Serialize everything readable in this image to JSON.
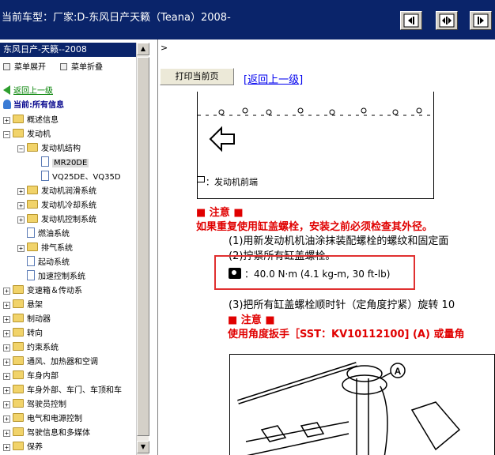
{
  "titlebar": {
    "title": "当前车型：厂家:D-东风日产天籁（Teana）2008-",
    "buttons": [
      "collapse-left-icon",
      "split-view-icon",
      "collapse-right-icon"
    ]
  },
  "sidebar": {
    "header": "东风日产-天籁--2008",
    "expand_label": "菜单展开",
    "collapse_label": "菜单折叠",
    "back_label": "返回上一级",
    "current_label": "当前:所有信息",
    "tree": [
      {
        "label": "概述信息",
        "type": "folder",
        "level": 0,
        "expanded": false
      },
      {
        "label": "发动机",
        "type": "folder",
        "level": 0,
        "expanded": true
      },
      {
        "label": "发动机结构",
        "type": "folder",
        "level": 1,
        "expanded": true
      },
      {
        "label": "MR20DE",
        "type": "doc",
        "level": 2,
        "selected": true
      },
      {
        "label": "VQ25DE、VQ35D",
        "type": "doc",
        "level": 2
      },
      {
        "label": "发动机润滑系统",
        "type": "folder",
        "level": 1,
        "expanded": false
      },
      {
        "label": "发动机冷却系统",
        "type": "folder",
        "level": 1,
        "expanded": false
      },
      {
        "label": "发动机控制系统",
        "type": "folder",
        "level": 1,
        "expanded": false
      },
      {
        "label": "燃油系统",
        "type": "doc",
        "level": 1
      },
      {
        "label": "排气系统",
        "type": "folder",
        "level": 1,
        "expanded": false
      },
      {
        "label": "起动系统",
        "type": "doc",
        "level": 1
      },
      {
        "label": "加速控制系统",
        "type": "doc",
        "level": 1
      },
      {
        "label": "变速箱＆传动系",
        "type": "folder",
        "level": 0,
        "expanded": false
      },
      {
        "label": "悬架",
        "type": "folder",
        "level": 0,
        "expanded": false
      },
      {
        "label": "制动器",
        "type": "folder",
        "level": 0,
        "expanded": false
      },
      {
        "label": "转向",
        "type": "folder",
        "level": 0,
        "expanded": false
      },
      {
        "label": "约束系统",
        "type": "folder",
        "level": 0,
        "expanded": false
      },
      {
        "label": "通风、加热器和空调",
        "type": "folder",
        "level": 0,
        "expanded": false
      },
      {
        "label": "车身内部",
        "type": "folder",
        "level": 0,
        "expanded": false
      },
      {
        "label": "车身外部、车门、车顶和车",
        "type": "folder",
        "level": 0,
        "expanded": false
      },
      {
        "label": "驾驶员控制",
        "type": "folder",
        "level": 0,
        "expanded": false
      },
      {
        "label": "电气和电源控制",
        "type": "folder",
        "level": 0,
        "expanded": false
      },
      {
        "label": "驾驶信息和多媒体",
        "type": "folder",
        "level": 0,
        "expanded": false
      },
      {
        "label": "保养",
        "type": "folder",
        "level": 0,
        "expanded": false
      }
    ]
  },
  "main": {
    "caret": ">",
    "print_label": "打印当前页",
    "back_link": "[返回上一级]",
    "front_note": "：发动机前端",
    "note_label": "■ 注意 ■",
    "warning1": "如果重复使用缸盖螺栓，安装之前必须检查其外径。",
    "step1": "(1)用新发动机机油涂抹装配螺栓的螺纹和固定面",
    "step2": "(2)拧紧所有缸盖螺栓。",
    "torque": "：40.0 N·m (4.1 kg-m, 30 ft-lb)",
    "step3": "(3)把所有缸盖螺栓顺时针（定角度拧紧）旋转 10",
    "note2_label": "■ 注意 ■",
    "warning2": "使用角度扳手［SST：KV10112100] (A) 或量角",
    "callout_a": "A",
    "accent_red": "#e00000",
    "highlight_box": "#e03030"
  }
}
